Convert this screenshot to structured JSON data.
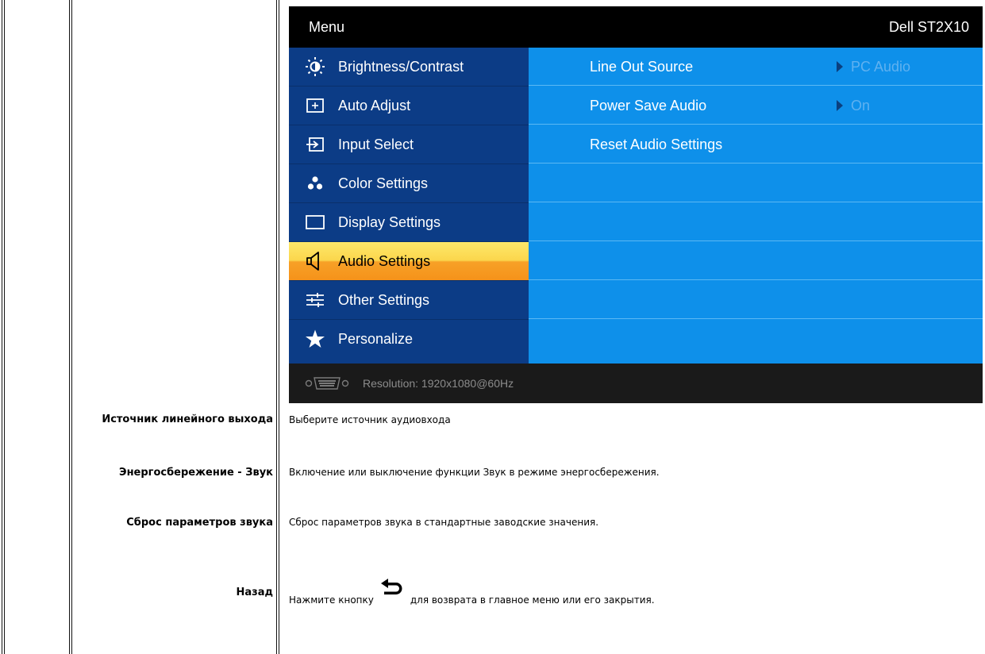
{
  "osd": {
    "menu_title": "Menu",
    "model": "Dell ST2X10",
    "menu_items": [
      {
        "label": "Brightness/Contrast",
        "icon": "brightness-icon"
      },
      {
        "label": "Auto Adjust",
        "icon": "auto-adjust-icon"
      },
      {
        "label": "Input Select",
        "icon": "input-select-icon"
      },
      {
        "label": "Color Settings",
        "icon": "color-settings-icon"
      },
      {
        "label": "Display Settings",
        "icon": "display-settings-icon"
      },
      {
        "label": "Audio Settings",
        "icon": "speaker-icon",
        "active": true
      },
      {
        "label": "Other Settings",
        "icon": "sliders-icon"
      },
      {
        "label": "Personalize",
        "icon": "star-icon"
      }
    ],
    "submenu": [
      {
        "label": "Line Out Source",
        "value": "PC Audio"
      },
      {
        "label": "Power Save Audio",
        "value": "On"
      },
      {
        "label": "Reset Audio Settings",
        "value": ""
      }
    ],
    "footer": {
      "resolution": "Resolution:  1920x1080@60Hz",
      "icon": "vga-connector-icon"
    },
    "colors": {
      "left_panel": "#0c3c86",
      "right_panel": "#0e90ea",
      "active_item": "#f7a127",
      "header": "#000000"
    }
  },
  "descriptions": [
    {
      "label": "Источник линейного выхода",
      "text": "Выберите источник аудиовхода"
    },
    {
      "label": "Энергосбережение - Звук",
      "text": "Включение или выключение функции Звук в режиме энергосбережения."
    },
    {
      "label": "Сброс параметров звука",
      "text": "Сброс параметров звука в стандартные заводские значения."
    },
    {
      "label": "Назад",
      "text_before": "Нажмите кнопку",
      "icon": "back-arrow-icon",
      "text_after": "для возврата в главное меню или его закрытия."
    }
  ]
}
